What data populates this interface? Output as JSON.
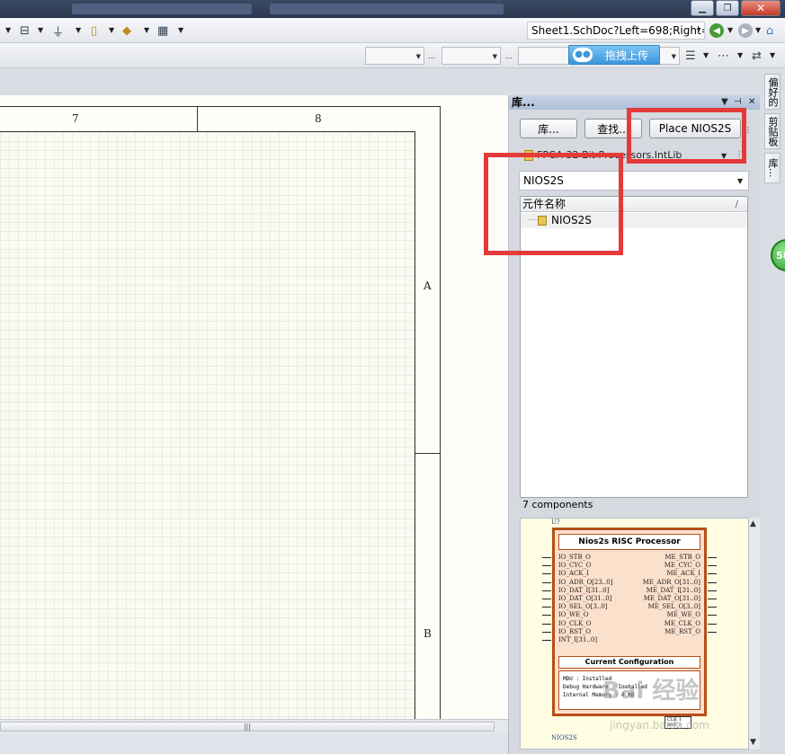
{
  "address": {
    "value": "Sheet1.SchDoc?Left=698;Right=",
    "dropdown": "▾"
  },
  "toolbar2": {
    "upload_label": "拖拽上传"
  },
  "sheet": {
    "col_labels": [
      "7",
      "8"
    ],
    "row_labels": [
      "A",
      "B"
    ]
  },
  "library_panel": {
    "title": "库...",
    "buttons": {
      "library": "库...",
      "search": "查找...",
      "place": "Place NIOS2S"
    },
    "library_file": "FPGA 32-Bit Processors.IntLib",
    "filter": "NIOS2S",
    "column_header": "元件名称",
    "components": [
      {
        "name": "NIOS2S"
      }
    ],
    "count_text": "7 components"
  },
  "preview": {
    "ref": "U?",
    "title": "Nios2s RISC Processor",
    "left_pins": [
      "IO_STB_O",
      "IO_CYC_O",
      "IO_ACK_I",
      "IO_ADR_O[23..0]",
      "IO_DAT_I[31..0]",
      "IO_DAT_O[31..0]",
      "IO_SEL_O[3..0]",
      "IO_WE_O",
      "IO_CLK_O",
      "IO_RST_O",
      "INT_I[31..0]"
    ],
    "right_pins": [
      "ME_STB_O",
      "ME_CYC_O",
      "ME_ACK_I",
      "ME_ADR_O[31..0]",
      "ME_DAT_I[31..0]",
      "ME_DAT_O[31..0]",
      "ME_SEL_O[3..0]",
      "ME_WE_O",
      "ME_CLK_O",
      "ME_RST_O"
    ],
    "config_title": "Current Configuration",
    "config_lines": [
      "MDU              : Installed",
      "Debug Hardware   : Installed",
      "Internal Memory  : 4 KB"
    ],
    "clk_label": "CLK_I",
    "rst_label": "RST_I",
    "name": "NIOS2S"
  },
  "side_tabs": [
    "偏好的",
    "剪贴板",
    "库..."
  ],
  "badge": "58",
  "watermark": {
    "main": "Bai 经验",
    "sub": "jingyan.baidu.com"
  },
  "colors": {
    "highlight": "#e53a3a",
    "chip_border": "#b64f1a",
    "chip_fill": "#fbe0cc",
    "upload_blue": "#3c97dc"
  }
}
